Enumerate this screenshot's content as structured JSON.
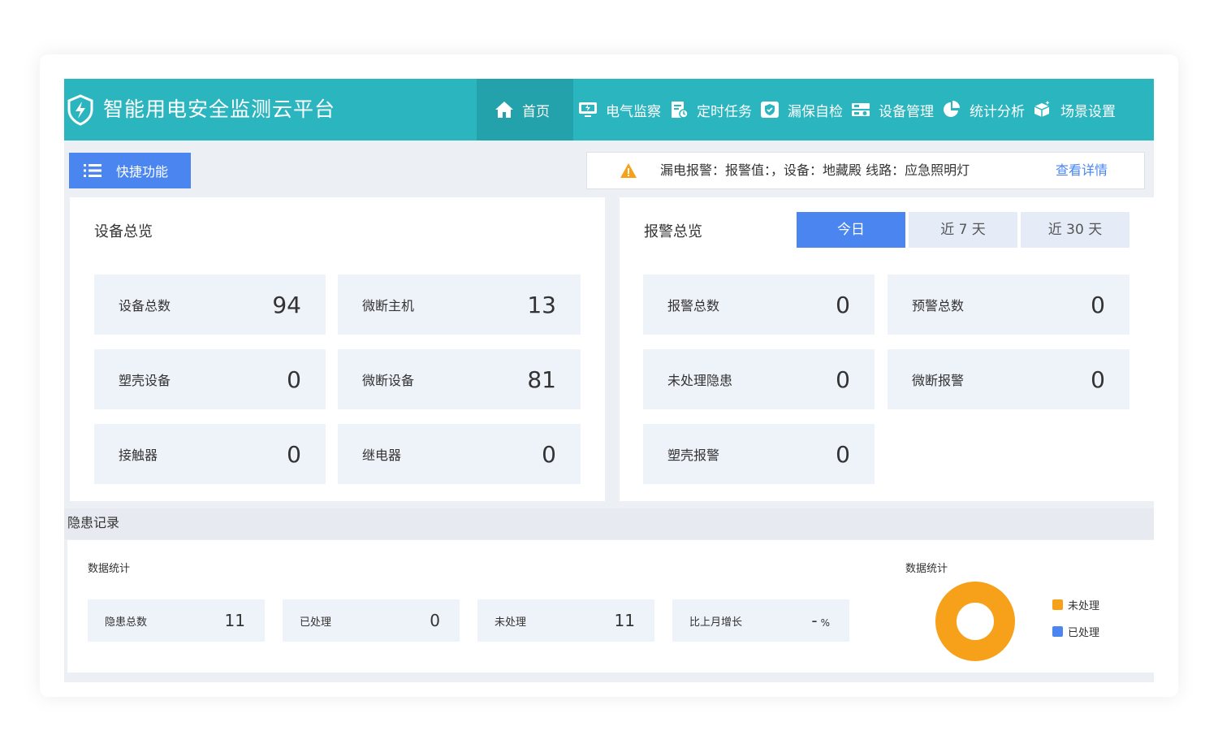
{
  "header": {
    "title": "智能用电安全监测云平台",
    "nav": [
      {
        "label": "首页",
        "icon": "home-icon",
        "active": true
      },
      {
        "label": "电气监察",
        "icon": "monitor-icon"
      },
      {
        "label": "定时任务",
        "icon": "clipboard-clock-icon"
      },
      {
        "label": "漏保自检",
        "icon": "shield-check-icon"
      },
      {
        "label": "设备管理",
        "icon": "device-grid-icon"
      },
      {
        "label": "统计分析",
        "icon": "pie-chart-icon"
      },
      {
        "label": "场景设置",
        "icon": "cube-icon"
      }
    ]
  },
  "toolbar": {
    "quick_label": "快捷功能",
    "alert_text": "漏电报警：报警值：，设备：地藏殿 线路：应急照明灯",
    "alert_link": "查看详情"
  },
  "device_overview": {
    "title": "设备总览",
    "stats": [
      {
        "label": "设备总数",
        "value": "94"
      },
      {
        "label": "微断主机",
        "value": "13"
      },
      {
        "label": "塑壳设备",
        "value": "0"
      },
      {
        "label": "微断设备",
        "value": "81"
      },
      {
        "label": "接触器",
        "value": "0"
      },
      {
        "label": "继电器",
        "value": "0"
      }
    ]
  },
  "alarm_overview": {
    "title": "报警总览",
    "tabs": [
      "今日",
      "近 7 天",
      "近 30 天"
    ],
    "stats": [
      {
        "label": "报警总数",
        "value": "0"
      },
      {
        "label": "预警总数",
        "value": "0"
      },
      {
        "label": "未处理隐患",
        "value": "0"
      },
      {
        "label": "微断报警",
        "value": "0"
      },
      {
        "label": "塑壳报警",
        "value": "0"
      }
    ]
  },
  "records": {
    "title": "隐患记录",
    "stats_title": "数据统计",
    "stats": [
      {
        "label": "隐患总数",
        "value": "11"
      },
      {
        "label": "已处理",
        "value": "0"
      },
      {
        "label": "未处理",
        "value": "11"
      },
      {
        "label": "比上月增长",
        "value": "-",
        "unit": "%"
      }
    ],
    "chart_title": "数据统计",
    "legend": [
      {
        "label": "未处理",
        "color": "#f7a11a",
        "value": 11
      },
      {
        "label": "已处理",
        "color": "#4b86f0",
        "value": 0
      }
    ]
  },
  "colors": {
    "header": "#2ab5bf",
    "accent": "#4b86f0",
    "orange": "#f7a11a"
  }
}
